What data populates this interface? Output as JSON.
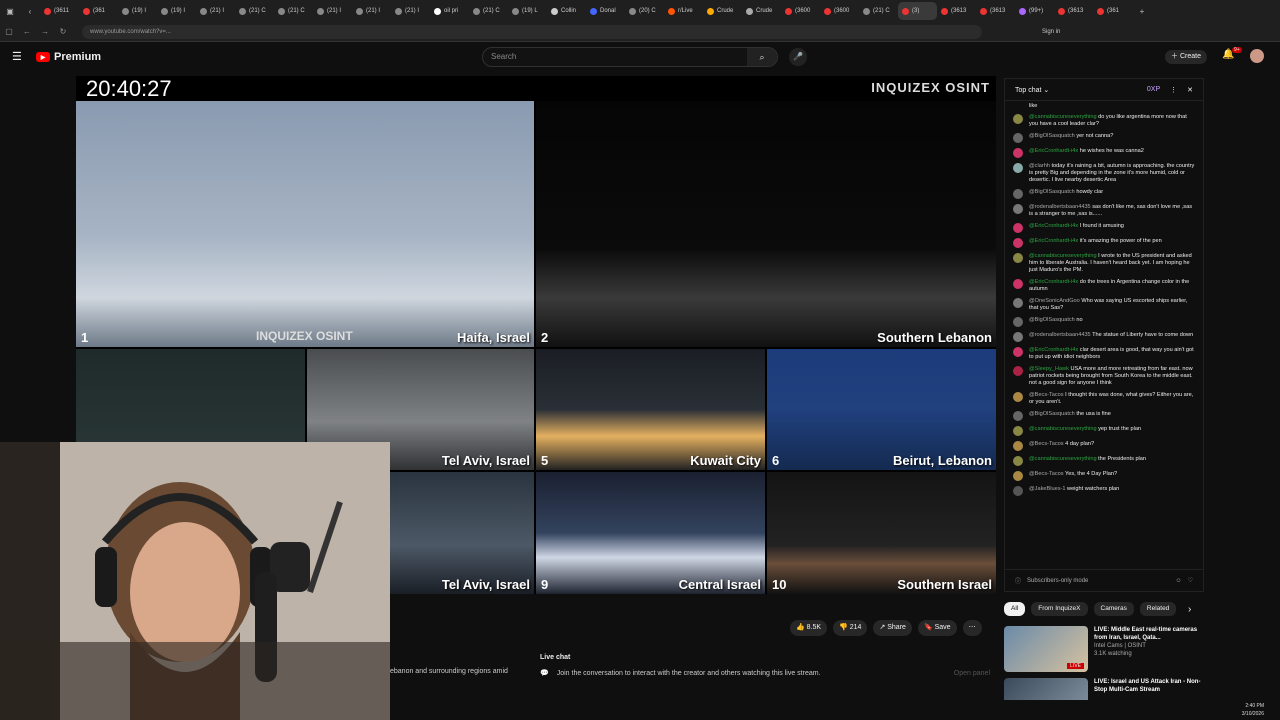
{
  "browser": {
    "tabs": [
      "(3611",
      "(361",
      "(19) I",
      "(19) I",
      "(21) I",
      "(21) C",
      "(21) C",
      "(21) I",
      "(21) I",
      "(21) I",
      "oil pri",
      "(21) C",
      "(19) L",
      "Collin",
      "Donal",
      "(20) C",
      "r/Live",
      "Crude",
      "Crude",
      "(3600",
      "(3600",
      "(21) C",
      "(3)",
      "(3613",
      "(3613",
      "(99+)",
      "(3613",
      "(361"
    ],
    "url": "www.youtube.com/watch?v=...",
    "signin": "Sign in"
  },
  "header": {
    "brand": "Premium",
    "search_placeholder": "Search",
    "create_label": "Create",
    "notif_badge": "9+"
  },
  "video": {
    "clock": "20:40:27",
    "watermark": "INQUIZEX OSINT",
    "cells": [
      {
        "num": "1",
        "label": "Haifa, Israel"
      },
      {
        "num": "2",
        "label": "Southern Lebanon"
      },
      {
        "num": "",
        "label": ""
      },
      {
        "num": "",
        "label": "Tel Aviv, Israel"
      },
      {
        "num": "5",
        "label": "Kuwait City"
      },
      {
        "num": "6",
        "label": "Beirut, Lebanon"
      },
      {
        "num": "",
        "label": "Tel Aviv, Israel"
      },
      {
        "num": "9",
        "label": "Central Israel"
      },
      {
        "num": "10",
        "label": "Southern Israel"
      }
    ],
    "cell_watermark": "INQUIZEX OSINT"
  },
  "actions": {
    "likes": "8.5K",
    "dislikes": "214",
    "share": "Share",
    "save": "Save"
  },
  "below": {
    "desc_snippet": "ebanon and surrounding regions amid",
    "live_chat_title": "Live chat",
    "live_chat_text": "Join the conversation to interact with the creator and others watching this live stream.",
    "open_panel": "Open panel"
  },
  "chat": {
    "mode": "Top chat",
    "xp": "0XP",
    "footer": "Subscribers-only mode",
    "first_fragment": "like",
    "messages": [
      {
        "author": "@cannabiscureseverything",
        "green": true,
        "text": "do you like argentina more now that you have a cool leader clar?"
      },
      {
        "author": "@BigOlSasquatch",
        "green": false,
        "text": "yer not canna?"
      },
      {
        "author": "@EricCronhardt-i4x",
        "green": true,
        "text": "he wishes he was canna2"
      },
      {
        "author": "@clarhh",
        "green": false,
        "text": "today it's raining a bit, autumn is approaching. the country is pretty Big and depending in the zone it's more humid, cold or desertic. I live nearby desertic Area"
      },
      {
        "author": "@BigOlSasquatch",
        "green": false,
        "text": "howdy clar"
      },
      {
        "author": "@rodenalbertsbaan4435",
        "green": false,
        "text": "sas don't like me, sas don't love me ,sas is a stranger to me ,sas is......"
      },
      {
        "author": "@EricCronhardt-i4x",
        "green": true,
        "text": "I found it amusing"
      },
      {
        "author": "@EricCronhardt-i4x",
        "green": true,
        "text": "it's amazing the power of the pen"
      },
      {
        "author": "@cannabiscureseverything",
        "green": true,
        "text": "I wrote to the US president and asked him to liberate Australia. I haven't heard back yet. I am hoping he just Maduro's the PM."
      },
      {
        "author": "@EricCronhardt-i4x",
        "green": true,
        "text": "do the trees in Argentina change color in the autumn"
      },
      {
        "author": "@OneSonicAndGoo",
        "green": false,
        "text": "Who was saying US escorted ships earlier, that you Sas?"
      },
      {
        "author": "@BigOlSasquatch",
        "green": false,
        "text": "no"
      },
      {
        "author": "@rodenalbertsbaan4435",
        "green": false,
        "text": "The statue of Liberty have to come down"
      },
      {
        "author": "@EricCronhardt-i4x",
        "green": true,
        "text": "clar desert area is good, that way you ain't got to put up with idiot neighbors"
      },
      {
        "author": "@Sleepy_Hawk",
        "green": true,
        "text": "USA more and more retreating from far east. now patriot rockets being brought from South Korea to the middle east. not a good sign for anyone I think"
      },
      {
        "author": "@Becs-Tacos",
        "green": false,
        "text": "I thought this was done, what gives? Either you are, or you aren't."
      },
      {
        "author": "@BigOlSasquatch",
        "green": false,
        "text": "the usa is fine"
      },
      {
        "author": "@cannabiscureseverything",
        "green": true,
        "text": "yep trust the plan"
      },
      {
        "author": "@Becs-Tacos",
        "green": false,
        "text": "4 day plan?"
      },
      {
        "author": "@cannabiscureseverything",
        "green": true,
        "text": "the Presidents plan"
      },
      {
        "author": "@Becs-Tacos",
        "green": false,
        "text": "Yes, the 4 Day Plan?"
      },
      {
        "author": "@JakeBlues-1",
        "green": false,
        "text": "weight watchers plan"
      }
    ]
  },
  "chips": [
    "All",
    "From InquizeX",
    "Cameras",
    "Related"
  ],
  "recommendations": [
    {
      "title": "LIVE: Middle East real-time cameras from Iran, Israel, Qata...",
      "channel": "Intel Cams | OSINT",
      "meta": "3.1K watching",
      "badge": "LIVE"
    },
    {
      "title": "LIVE: Israel and US Attack Iran - Non-Stop Multi-Cam Stream",
      "channel": "",
      "meta": "",
      "badge": ""
    }
  ],
  "taskbar": {
    "time": "2:40 PM",
    "date": "3/10/2026"
  },
  "colors": {
    "bg": "#0f0f0f",
    "brand_red": "#ff0000",
    "green_author": "#2ba640"
  }
}
